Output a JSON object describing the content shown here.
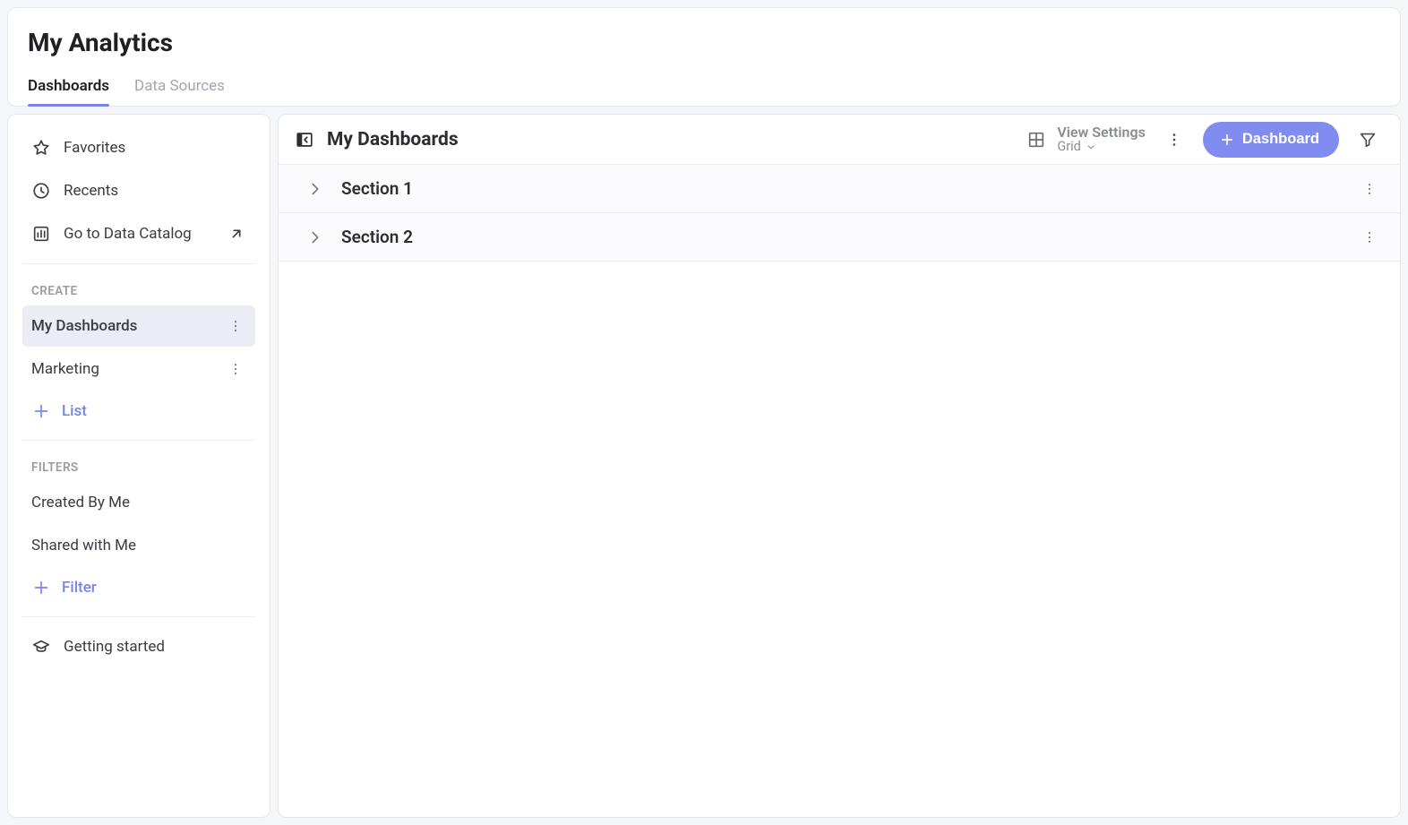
{
  "header": {
    "title": "My Analytics",
    "tabs": [
      {
        "label": "Dashboards",
        "active": true
      },
      {
        "label": "Data Sources",
        "active": false
      }
    ]
  },
  "sidebar": {
    "top": [
      {
        "icon": "star-icon",
        "label": "Favorites"
      },
      {
        "icon": "clock-icon",
        "label": "Recents"
      },
      {
        "icon": "catalog-icon",
        "label": "Go to Data Catalog",
        "external": true
      }
    ],
    "create_header": "CREATE",
    "create_items": [
      {
        "label": "My Dashboards",
        "selected": true,
        "has_more": true
      },
      {
        "label": "Marketing",
        "selected": false,
        "has_more": true
      }
    ],
    "add_list_label": "List",
    "filters_header": "FILTERS",
    "filters": [
      {
        "label": "Created By Me"
      },
      {
        "label": "Shared with Me"
      }
    ],
    "add_filter_label": "Filter",
    "footer": {
      "icon": "grad-cap-icon",
      "label": "Getting started"
    }
  },
  "main": {
    "title": "My Dashboards",
    "view_settings": {
      "title": "View Settings",
      "mode": "Grid"
    },
    "add_button_label": "Dashboard",
    "sections": [
      {
        "title": "Section 1"
      },
      {
        "title": "Section 2"
      }
    ]
  }
}
